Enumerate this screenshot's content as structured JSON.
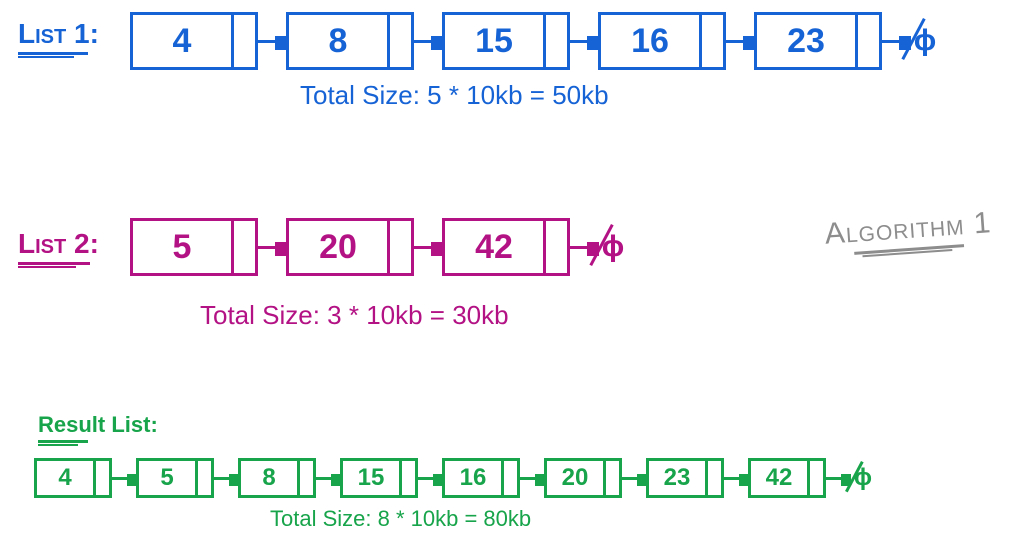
{
  "colors": {
    "list1": "#1663d6",
    "list2": "#b31285",
    "result": "#17a44a",
    "side": "#8d8d8d"
  },
  "null_symbol": "ϕ",
  "side_title": "Algorithm 1",
  "list1": {
    "label": "List 1:",
    "caption": "Total Size: 5 * 10kb = 50kb",
    "nodes": [
      "4",
      "8",
      "15",
      "16",
      "23"
    ]
  },
  "list2": {
    "label": "List 2:",
    "caption": "Total Size: 3 * 10kb = 30kb",
    "nodes": [
      "5",
      "20",
      "42"
    ]
  },
  "result": {
    "label": "Result List:",
    "caption": "Total Size: 8 * 10kb = 80kb",
    "nodes": [
      "4",
      "5",
      "8",
      "15",
      "16",
      "20",
      "23",
      "42"
    ]
  }
}
